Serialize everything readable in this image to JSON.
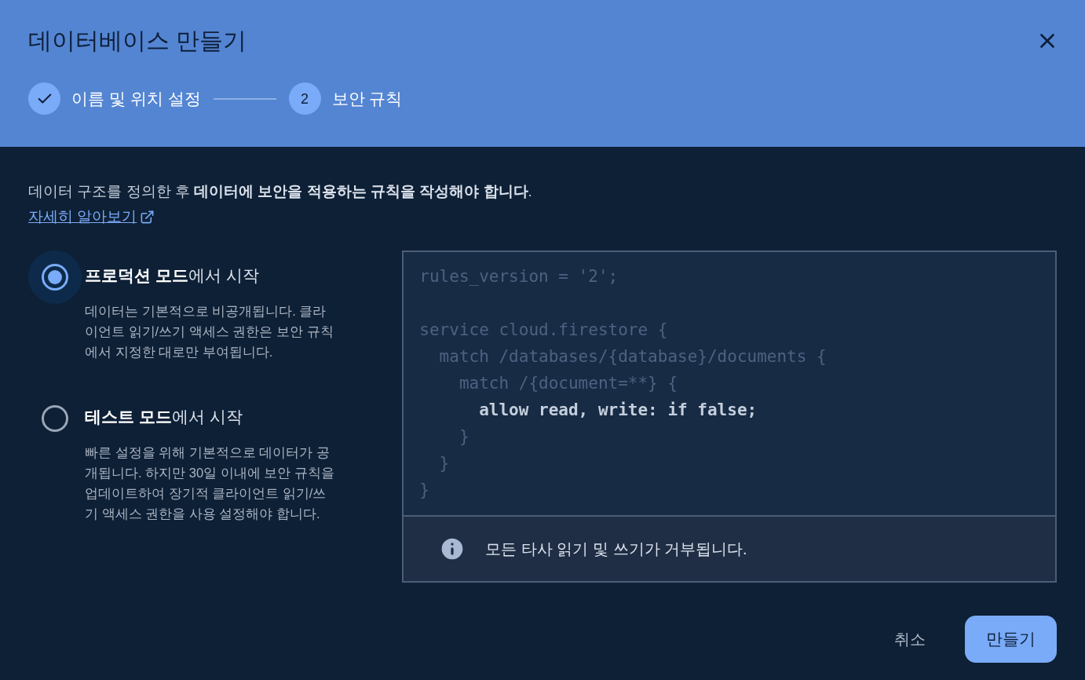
{
  "dialog": {
    "title": "데이터베이스 만들기"
  },
  "steps": [
    {
      "label": "이름 및 위치 설정",
      "done": true
    },
    {
      "label": "보안 규칙",
      "done": false,
      "number": "2"
    }
  ],
  "intro": "데이터 구조를 정의한 후 **데이터에 보안을 적용하는 규칙을 작성해야 합니다**.",
  "learn_more": "자세히 알아보기",
  "modes": [
    {
      "title": "**프로덕션 모드**에서 시작",
      "description": "데이터는 기본적으로 비공개됩니다. 클라이언트 읽기/쓰기 액세스 권한은 보안 규칙에서 지정한 대로만 부여됩니다.",
      "selected": true
    },
    {
      "title": "**테스트 모드**에서 시작",
      "description": "빠른 설정을 위해 기본적으로 데이터가 공개됩니다. 하지만 30일 이내에 보안 규칙을 업데이트하여 장기적 클라이언트 읽기/쓰기 액세스 권한을 사용 설정해야 합니다.",
      "selected": false
    }
  ],
  "code_blocks": [
    {
      "lines": [
        {
          "text": "rules_version = '2';",
          "bold": false
        }
      ]
    },
    {
      "lines": [
        {
          "text": "service cloud.firestore {",
          "bold": false
        },
        {
          "text": "  match /databases/{database}/documents {",
          "bold": false
        },
        {
          "text": "    match /{document=**} {",
          "bold": false
        },
        {
          "text": "      allow read, write: if false;",
          "bold": true
        },
        {
          "text": "    }",
          "bold": false
        },
        {
          "text": "  }",
          "bold": false
        },
        {
          "text": "}",
          "bold": false
        }
      ]
    }
  ],
  "notice": "모든 타사 읽기 및 쓰기가 거부됩니다.",
  "buttons": {
    "cancel": "취소",
    "create": "만들기"
  }
}
